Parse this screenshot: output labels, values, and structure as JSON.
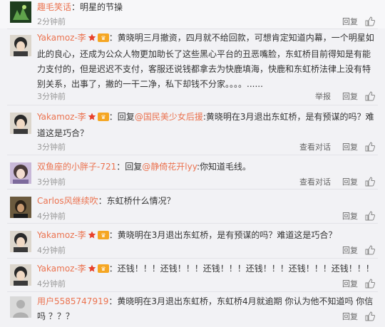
{
  "colors": {
    "accent": "#eb7350",
    "meta": "#999999",
    "text": "#333333"
  },
  "comments": [
    {
      "name": "趣毛笑话",
      "text": "：明星的节操",
      "time": "2分钟前",
      "actions": [
        "回复"
      ]
    },
    {
      "name": "Yakamoz-李",
      "text": "：黄晓明三月撤资，四月就不给回款，可想肯定知道内幕，一个明星如此的良心，还成为公众人物更加助长了这些黑心平台的丑恶嘴脸，东虹桥目前得知是有能力支付的，但是迟迟不支付，客服还说钱都拿去为快鹿填海，快鹿和东虹桥法律上没有特别关系，出事了，撇的一干二净，私下却钱不分家。。。。......",
      "time": "3分钟前",
      "actions": [
        "举报",
        "回复"
      ]
    },
    {
      "name": "Yakamoz-李",
      "text_pre": "：回复",
      "at": "@国民美少女后援",
      "text": ":黄晓明在3月退出东虹桥，是有预谋的吗？难道这是巧合？",
      "time": "3分钟前",
      "actions": [
        "查看对话",
        "回复"
      ]
    },
    {
      "name": "双鱼座的小胖子-721",
      "text_pre": "：回复",
      "at": "@静倚花开lyy",
      "text": ":你知道毛线。",
      "time": "3分钟前",
      "actions": [
        "查看对话",
        "回复"
      ]
    },
    {
      "name": "Carlos风继续吹",
      "text": "：东虹桥什么情况？",
      "time": "4分钟前",
      "actions": [
        "回复"
      ]
    },
    {
      "name": "Yakamoz-李",
      "text": "：黄晓明在3月退出东虹桥，是有预谋的吗？难道这是巧合？",
      "time": "4分钟前",
      "actions": [
        "回复"
      ]
    },
    {
      "name": "Yakamoz-李",
      "text": "：还钱！！！还钱！！！还钱！！！还钱！！！还钱！！！还钱！！！",
      "time": "4分钟前",
      "actions": [
        "回复"
      ]
    },
    {
      "name": "用户5585747919",
      "text": "：黄晓明在3月退出东虹桥，东虹桥4月就逾期 你认为他不知道吗  你信吗 ？？？",
      "time": "",
      "actions": [
        "回复"
      ]
    }
  ]
}
